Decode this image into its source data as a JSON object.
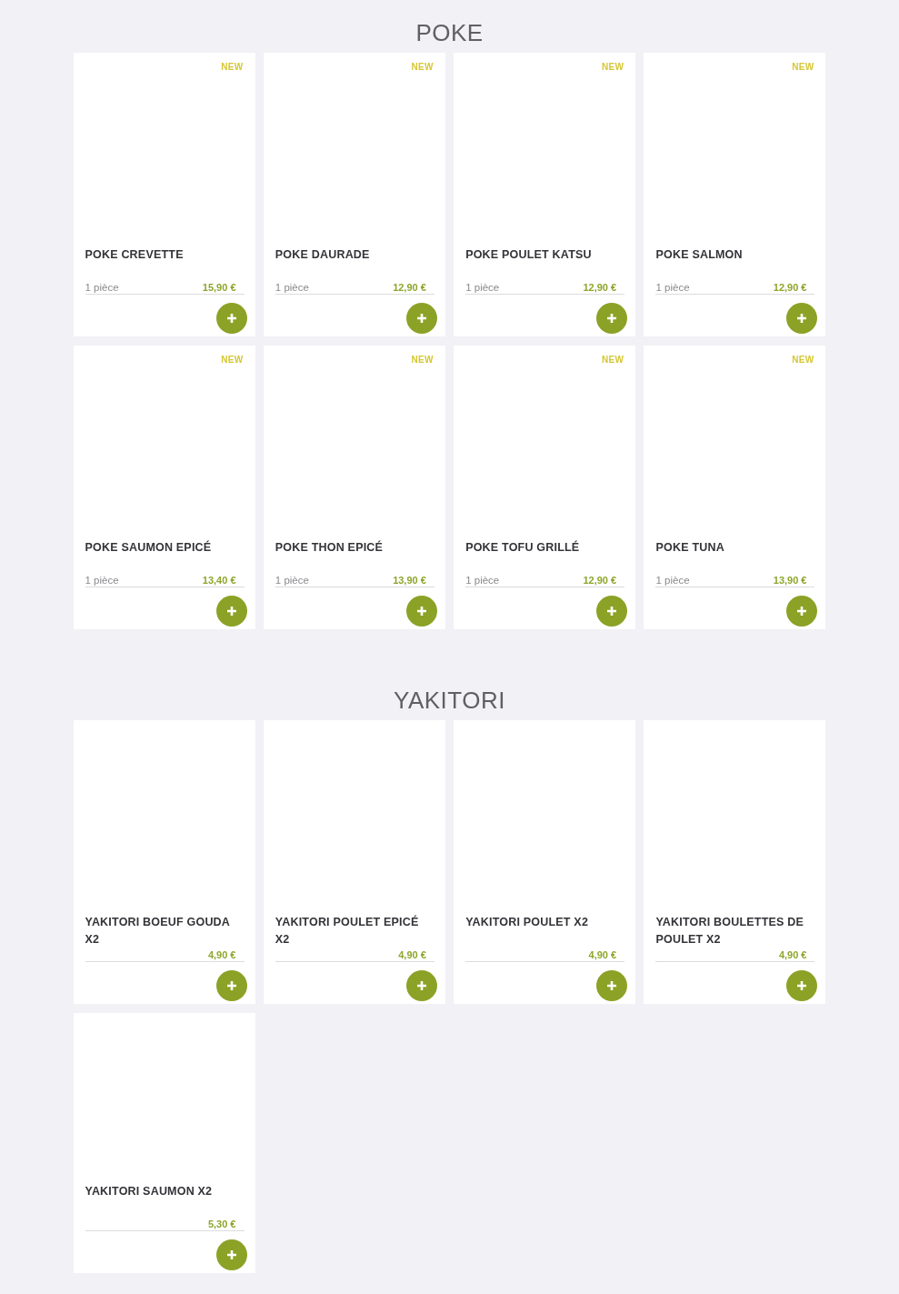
{
  "sections": [
    {
      "title": "POKE",
      "items": [
        {
          "badge": "NEW",
          "name": "POKE CREVETTE",
          "quantity": "1 pièce",
          "price": "15,90 €"
        },
        {
          "badge": "NEW",
          "name": "POKE DAURADE",
          "quantity": "1 pièce",
          "price": "12,90 €"
        },
        {
          "badge": "NEW",
          "name": "POKE POULET KATSU",
          "quantity": "1 pièce",
          "price": "12,90 €"
        },
        {
          "badge": "NEW",
          "name": "POKE SALMON",
          "quantity": "1 pièce",
          "price": "12,90 €"
        },
        {
          "badge": "NEW",
          "name": "POKE SAUMON EPICÉ",
          "quantity": "1 pièce",
          "price": "13,40 €"
        },
        {
          "badge": "NEW",
          "name": "POKE THON EPICÉ",
          "quantity": "1 pièce",
          "price": "13,90 €"
        },
        {
          "badge": "NEW",
          "name": "POKE TOFU GRILLÉ",
          "quantity": "1 pièce",
          "price": "12,90 €"
        },
        {
          "badge": "NEW",
          "name": "POKE TUNA",
          "quantity": "1 pièce",
          "price": "13,90 €"
        }
      ]
    },
    {
      "title": "YAKITORI",
      "items": [
        {
          "name": "YAKITORI BOEUF GOUDA X2",
          "price": "4,90 €"
        },
        {
          "name": "YAKITORI POULET EPICÉ X2",
          "price": "4,90 €"
        },
        {
          "name": "YAKITORI POULET X2",
          "price": "4,90 €"
        },
        {
          "name": "YAKITORI BOULETTES DE POULET X2",
          "price": "4,90 €"
        },
        {
          "name": "YAKITORI SAUMON X2",
          "price": "5,30 €"
        }
      ]
    }
  ]
}
